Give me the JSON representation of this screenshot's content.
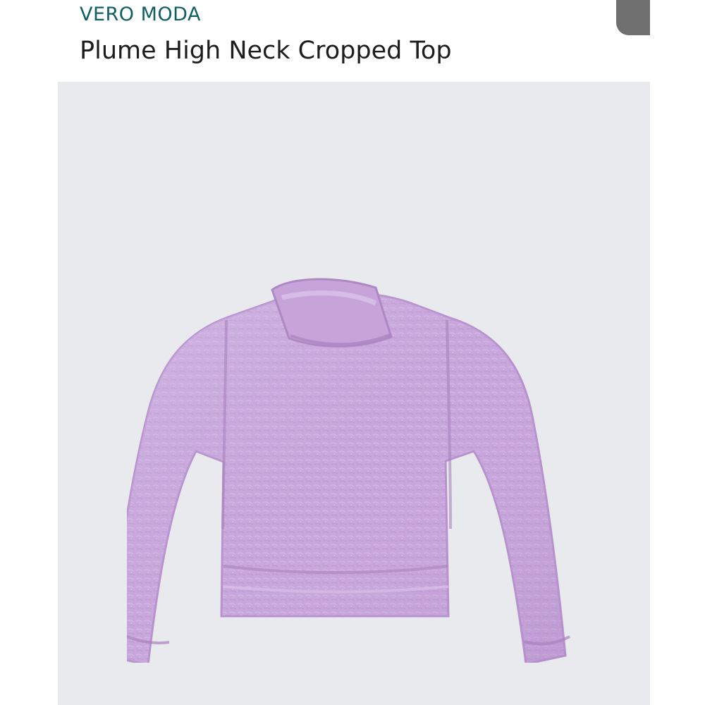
{
  "header": {
    "brand": "VERO MODA",
    "title": "Plume High Neck Cropped Top"
  },
  "product_image": {
    "subject": "sweater-image",
    "color": "#c8a7dc"
  },
  "colors": {
    "brand": "#0f5f63",
    "title": "#1d1d1d",
    "image_bg": "#e9eaee",
    "sweater": "#c8a7dc",
    "sweater_shadow": "#b996cf",
    "sweater_highlight": "#dcc6eb"
  }
}
